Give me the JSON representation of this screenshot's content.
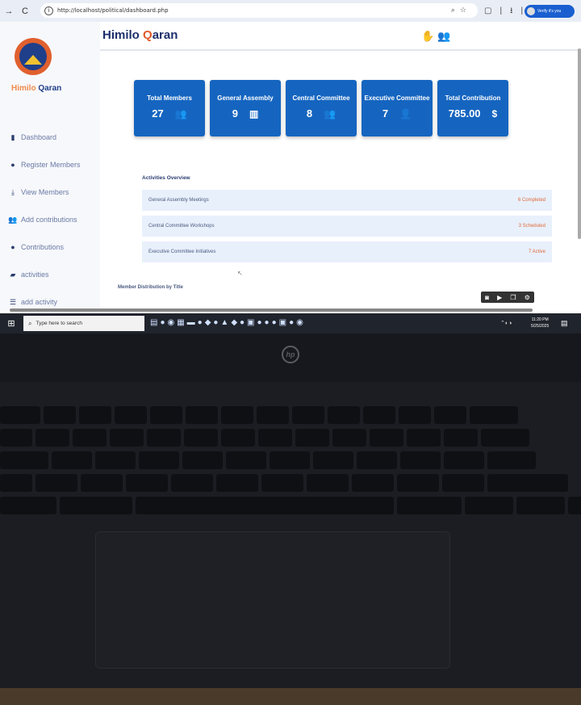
{
  "browser": {
    "url": "http://localhost/political/dashboard.php",
    "profile_label": "Verify it's you"
  },
  "sidebar": {
    "brand_first": "Himilo ",
    "brand_second": "Qaran",
    "items": [
      {
        "label": "Dashboard",
        "icon": "dashboard-icon"
      },
      {
        "label": "Register Members",
        "icon": "register-icon"
      },
      {
        "label": "View Members",
        "icon": "view-members-icon"
      },
      {
        "label": "Add contributions",
        "icon": "contributions-add-icon"
      },
      {
        "label": "Contributions",
        "icon": "contributions-icon"
      },
      {
        "label": "activities",
        "icon": "activities-icon"
      },
      {
        "label": "add activity",
        "icon": "add-activity-icon"
      }
    ]
  },
  "header": {
    "title_first": "Himilo ",
    "title_q": "Q",
    "title_rest": "aran"
  },
  "stats": [
    {
      "title": "Total Members",
      "value": "27",
      "icon": "users-icon"
    },
    {
      "title": "General Assembly",
      "value": "9",
      "icon": "building-icon"
    },
    {
      "title": "Central Committee",
      "value": "8",
      "icon": "users-icon"
    },
    {
      "title": "Executive Committee",
      "value": "7",
      "icon": "user-icon"
    },
    {
      "title": "Total Contribution",
      "value": "785.00",
      "icon": "dollar-icon"
    }
  ],
  "activities": {
    "heading": "Activities Overview",
    "rows": [
      {
        "name": "General Assembly Meetings",
        "status": "6 Completed"
      },
      {
        "name": "Central Committee Workshops",
        "status": "3 Scheduled"
      },
      {
        "name": "Executive Committee Initiatives",
        "status": "7 Active"
      }
    ]
  },
  "distribution_heading": "Member Distribution by Title",
  "taskbar": {
    "search_placeholder": "Type here to search",
    "time": "11:20 PM",
    "date": "5/25/2025"
  },
  "colors": {
    "card_blue": "#1565c0",
    "brand_orange": "#e05a2a",
    "brand_navy": "#1d2f6b"
  }
}
